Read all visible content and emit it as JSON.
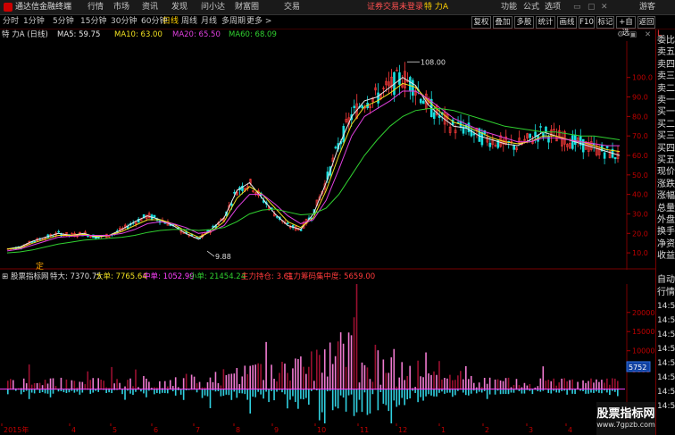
{
  "menubar": {
    "app_name": "通达信金融终端",
    "menus": [
      "行情",
      "市场",
      "资讯",
      "发现",
      "问小达",
      "财富圈",
      "交易"
    ],
    "login_status": "证券交易未登录",
    "stock_title": "特 力A",
    "right_items": [
      "功能",
      "公式",
      "选项"
    ],
    "guest": "游客"
  },
  "toolbar": {
    "periods": [
      "分时",
      "1分钟",
      "5分钟",
      "15分钟",
      "30分钟",
      "60分钟",
      "日线",
      "周线",
      "月线",
      "多周期",
      "更多 >"
    ],
    "active_period": "日线",
    "buttons": [
      "复权",
      "叠加",
      "多股",
      "统计",
      "画线",
      "F10",
      "标记",
      "+自选",
      "返回"
    ]
  },
  "ma_line": {
    "stock": "特 力A (日线)",
    "ma5": "MA5: 59.75",
    "ma10": "MA10: 63.00",
    "ma20": "MA20: 65.50",
    "ma60": "MA60: 68.09"
  },
  "colors": {
    "up": "#ff3b3b",
    "down": "#18e0e0",
    "ma5": "#e8e8e8",
    "ma10": "#f0e020",
    "ma20": "#e040e0",
    "ma60": "#30d030",
    "vol_pos": "#f07ad0",
    "vol_pos_dark": "#9a1030",
    "vol_neg": "#30d0e0",
    "orange": "#ffa500",
    "magenta": "#ff40ff"
  },
  "price_labels": {
    "high": "108.00",
    "low": "9.88",
    "marker": "定"
  },
  "volume_line": {
    "title": "股票指标网",
    "te_da": "特大: 7370.75",
    "da_dan": "大单: 7765.64",
    "zhong_dan": "中单: 1052.99",
    "xiao_dan": "小单: 21454.24",
    "zhuli_chicang": "主力持仓: 3.61",
    "zhuli_choumai": "主力筹码集中度: 5659.00"
  },
  "right_panel": {
    "top_code": "L",
    "items": [
      "委比",
      "卖五",
      "卖四",
      "卖三",
      "卖二",
      "卖一",
      "买一",
      "买二",
      "买三",
      "买四",
      "买五",
      "现价",
      "涨跌",
      "涨幅",
      "总量",
      "外盘",
      "换手",
      "净资",
      "收益"
    ],
    "vol_label": "自动",
    "vol_label2": "行情",
    "time_items": [
      "14:56",
      "14:56",
      "14:56",
      "14:56",
      "14:56",
      "14:56",
      "14:56",
      "14:5"
    ]
  },
  "chart_data": {
    "type": "line",
    "title": "",
    "y_ticks": [
      10.0,
      20.0,
      30.0,
      40.0,
      50.0,
      60.0,
      70.0,
      80.0,
      90.0,
      100.0
    ],
    "ylim": [
      5,
      115
    ],
    "x_ticks": [
      "2015年",
      "4",
      "5",
      "6",
      "7",
      "8",
      "9",
      "10",
      "11",
      "12",
      "1",
      "2",
      "3",
      "4"
    ],
    "volume_ticks": [
      20000,
      15000,
      10000,
      5000
    ],
    "volume_current_label": "5752",
    "volume_ylim": [
      -8000,
      26000
    ],
    "series": [
      {
        "name": "MA5",
        "values": [
          12,
          13,
          16,
          18,
          20,
          19,
          20,
          18,
          19,
          22,
          26,
          29,
          27,
          24,
          20,
          17,
          22,
          28,
          42,
          46,
          38,
          30,
          24,
          22,
          30,
          46,
          65,
          80,
          88,
          90,
          95,
          100,
          96,
          86,
          80,
          75,
          74,
          70,
          68,
          66,
          65,
          68,
          72,
          70,
          68,
          66,
          64,
          62,
          60
        ]
      },
      {
        "name": "MA10",
        "values": [
          12,
          12.5,
          15,
          17,
          19,
          19,
          19.5,
          18.5,
          19,
          21,
          24,
          27,
          27,
          25,
          21,
          18,
          21,
          26,
          38,
          44,
          40,
          33,
          26,
          23,
          28,
          42,
          60,
          76,
          85,
          88,
          92,
          97,
          95,
          88,
          82,
          77,
          75,
          72,
          69,
          67,
          66,
          67,
          70,
          70,
          68,
          67,
          65,
          63,
          62
        ]
      },
      {
        "name": "MA20",
        "values": [
          11,
          12,
          14,
          16,
          18,
          18.5,
          19,
          19,
          19,
          20,
          22,
          25,
          26,
          25,
          23,
          20,
          21,
          24,
          33,
          40,
          40,
          35,
          29,
          25,
          27,
          37,
          53,
          70,
          80,
          84,
          88,
          93,
          93,
          89,
          84,
          79,
          76,
          73,
          71,
          69,
          67,
          67,
          69,
          69,
          68,
          67,
          66,
          65,
          65
        ]
      },
      {
        "name": "MA60",
        "values": [
          10,
          10.5,
          11.5,
          13,
          14.5,
          15.5,
          16.5,
          17,
          17.5,
          18,
          19,
          20.5,
          21.5,
          22,
          22,
          21.5,
          22,
          23,
          26,
          30,
          32,
          32.5,
          31,
          29.5,
          30,
          33,
          40,
          50,
          60,
          68,
          75,
          80,
          83,
          84,
          84,
          83,
          81,
          79,
          77,
          75,
          74,
          73,
          72,
          72,
          71,
          70,
          70,
          69,
          68
        ]
      }
    ]
  }
}
